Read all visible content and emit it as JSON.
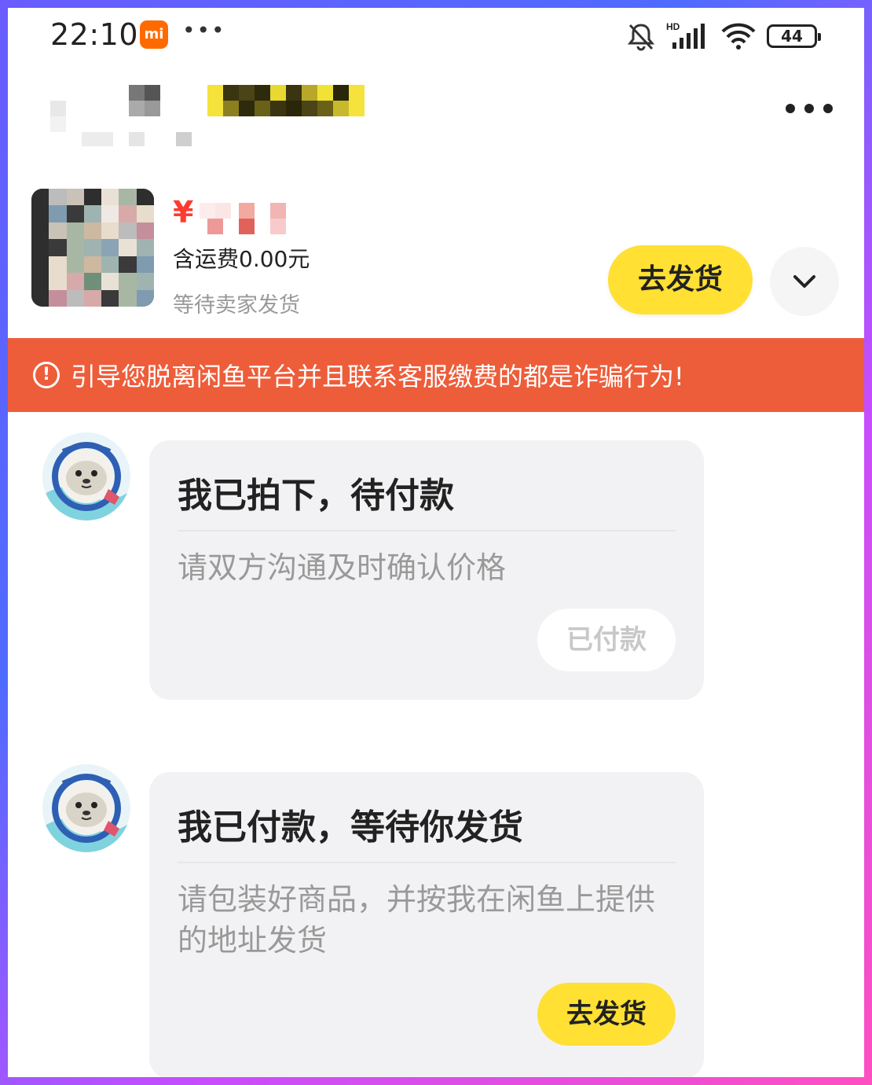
{
  "status_bar": {
    "time": "22:10",
    "mi_label": "mi",
    "more": "•••",
    "battery": "44",
    "network": "HD"
  },
  "product": {
    "currency": "¥",
    "shipping": "含运费0.00元",
    "status": "等待卖家发货",
    "ship_button": "去发货"
  },
  "warning": {
    "text": "引导您脱离闲鱼平台并且联系客服缴费的都是诈骗行为!",
    "icon": "!"
  },
  "messages": [
    {
      "title": "我已拍下，待付款",
      "body": "请双方沟通及时确认价格",
      "action": "已付款"
    },
    {
      "title": "我已付款，等待你发货",
      "body": "请包装好商品，并按我在闲鱼上提供的地址发货",
      "action": "去发货"
    }
  ],
  "colors": {
    "accent_yellow": "#ffe033",
    "warning_red": "#ee5d3a",
    "price_red": "#ff3b30"
  }
}
